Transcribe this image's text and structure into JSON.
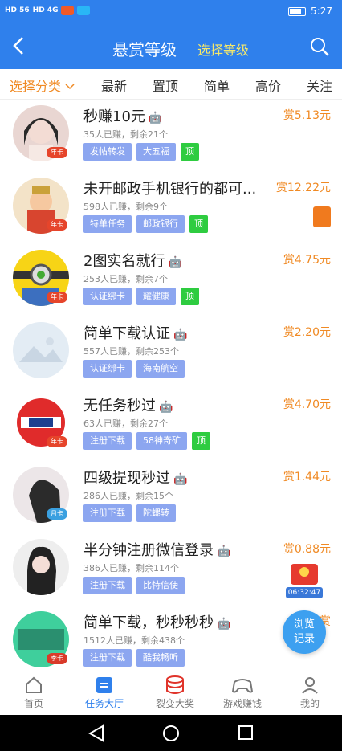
{
  "status_bar": {
    "time": "5:27",
    "sig1": "HD 56",
    "sig2": "HD 4G"
  },
  "header": {
    "title": "悬赏等级",
    "subtitle": "选择等级"
  },
  "tabs": [
    {
      "label": "选择分类"
    },
    {
      "label": "最新"
    },
    {
      "label": "置顶"
    },
    {
      "label": "简单"
    },
    {
      "label": "高价"
    },
    {
      "label": "关注"
    }
  ],
  "items": [
    {
      "title": "秒赚10元",
      "os": "🤖",
      "meta": "35人已赚，剩余21个",
      "tags": [
        "发帖转发",
        "大五福"
      ],
      "top": "顶",
      "reward": "赏5.13元",
      "badge": "年卡"
    },
    {
      "title": "未开邮政手机银行的都可...",
      "os": "",
      "meta": "598人已赚，剩余9个",
      "tags": [
        "特单任务",
        "邮政银行"
      ],
      "top": "顶",
      "reward": "赏12.22元",
      "badge": "年卡"
    },
    {
      "title": "2图实名就行",
      "os": "🤖",
      "meta": "253人已赚，剩余7个",
      "tags": [
        "认证绑卡",
        "耀健康"
      ],
      "top": "顶",
      "reward": "赏4.75元",
      "badge": "年卡"
    },
    {
      "title": "简单下载认证",
      "os": "🤖",
      "meta": "557人已赚，剩余253个",
      "tags": [
        "认证绑卡",
        "海南航空"
      ],
      "top": "",
      "reward": "赏2.20元",
      "badge": ""
    },
    {
      "title": "无任务秒过",
      "os": "🤖",
      "meta": "63人已赚，剩余27个",
      "tags": [
        "注册下载",
        "58神奇矿"
      ],
      "top": "顶",
      "reward": "赏4.70元",
      "badge": "年卡"
    },
    {
      "title": "四级提现秒过",
      "os": "🤖",
      "meta": "286人已赚，剩余15个",
      "tags": [
        "注册下载",
        "陀螺转"
      ],
      "top": "",
      "reward": "赏1.44元",
      "badge": "月卡"
    },
    {
      "title": "半分钟注册微信登录",
      "os": "🤖",
      "meta": "386人已赚，剩余114个",
      "tags": [
        "注册下载",
        "比特信使"
      ],
      "top": "",
      "reward": "赏0.88元",
      "badge": ""
    },
    {
      "title": "简单下载，秒秒秒秒",
      "os": "🤖",
      "meta": "1512人已赚，剩余438个",
      "tags": [
        "注册下载",
        "酷我畅听"
      ],
      "top": "",
      "reward": "赏",
      "badge": "季卡"
    }
  ],
  "floating": {
    "browse": "浏览",
    "record": "记录",
    "timer": "06:32:47"
  },
  "bottom_nav": [
    {
      "label": "首页"
    },
    {
      "label": "任务大厅"
    },
    {
      "label": "裂变大奖"
    },
    {
      "label": "游戏赚钱"
    },
    {
      "label": "我的"
    }
  ],
  "colors": {
    "primary": "#2f80ec",
    "accent": "#f08a24",
    "tag": "#8ca6f0",
    "top": "#2ecc40"
  }
}
